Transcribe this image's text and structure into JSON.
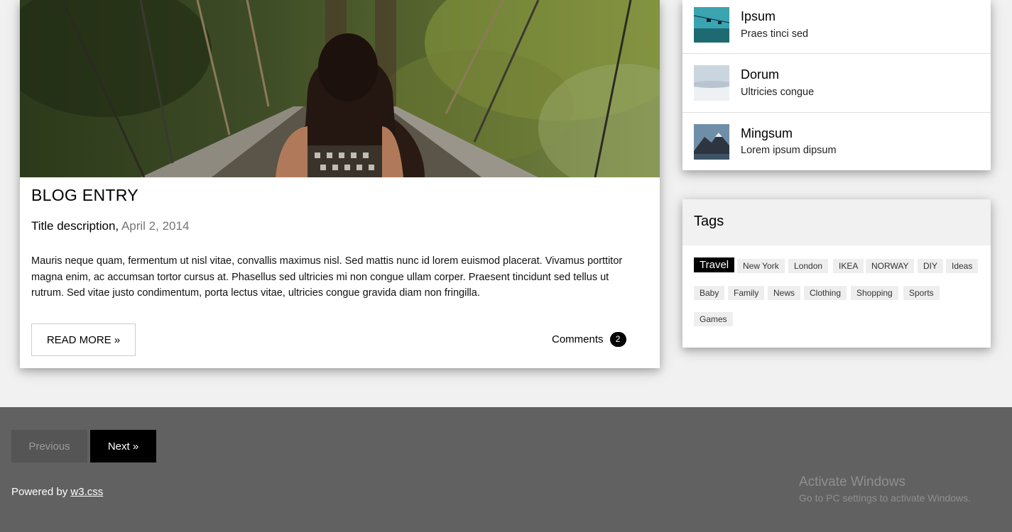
{
  "blog": {
    "title": "BLOG ENTRY",
    "subtitle": "Title description,",
    "date": "April 2, 2014",
    "body": "Mauris neque quam, fermentum ut nisl vitae, convallis maximus nisl. Sed mattis nunc id lorem euismod placerat. Vivamus porttitor magna enim, ac accumsan tortor cursus at. Phasellus sed ultricies mi non congue ullam corper. Praesent tincidunt sed tellus ut rutrum. Sed vitae justo condimentum, porta lectus vitae, ultricies congue gravida diam non fringilla.",
    "read_more": "READ MORE »",
    "comments_label": "Comments",
    "comments_count": "2"
  },
  "sidebar": {
    "items": [
      {
        "name": "Ipsum",
        "desc": "Praes tinci sed"
      },
      {
        "name": "Dorum",
        "desc": "Ultricies congue"
      },
      {
        "name": "Mingsum",
        "desc": "Lorem ipsum dipsum"
      }
    ]
  },
  "tags": {
    "title": "Tags",
    "items": [
      "Travel",
      "New York",
      "London",
      "IKEA",
      "NORWAY",
      "DIY",
      "Ideas",
      "Baby",
      "Family",
      "News",
      "Clothing",
      "Shopping",
      "Sports",
      "Games"
    ],
    "active": "Travel"
  },
  "footer": {
    "previous": "Previous",
    "next": "Next »",
    "powered_prefix": "Powered by",
    "powered_link": "w3.css"
  },
  "os_watermark": {
    "line1": "Activate Windows",
    "line2": "Go to PC settings to activate Windows."
  }
}
